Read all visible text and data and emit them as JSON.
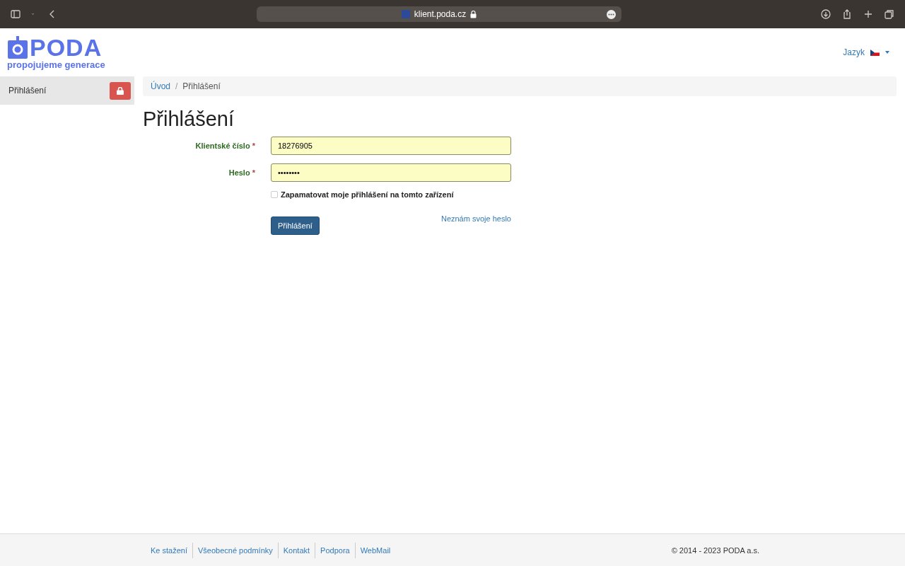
{
  "browser": {
    "url": "klient.poda.cz"
  },
  "logo": {
    "name": "PODA",
    "tagline": "propojujeme generace"
  },
  "language": {
    "label": "Jazyk"
  },
  "sidebar": {
    "items": [
      {
        "label": "Přihlášení",
        "selected": true
      }
    ]
  },
  "breadcrumb_separator": "/",
  "breadcrumb": [
    {
      "label": "Úvod",
      "link": true
    },
    {
      "label": "Přihlášení",
      "link": false
    }
  ],
  "title": "Přihlášení",
  "form": {
    "fields": [
      {
        "label": "Klientské číslo",
        "required_mark": "*",
        "value": "18276905"
      },
      {
        "label": "Heslo",
        "required_mark": "*",
        "value": "••••••••"
      }
    ],
    "remember": {
      "label": "Zapamatovat moje přihlášení na tomto zařízení",
      "checked": false
    },
    "submit": "Přihlášení",
    "forgot_link": "Neznám svoje heslo"
  },
  "footer": {
    "links": [
      "Ke stažení",
      "Všeobecné podmínky",
      "Kontakt",
      "Podpora",
      "WebMail"
    ],
    "copyright": "© 2014 - 2023 PODA a.s."
  }
}
